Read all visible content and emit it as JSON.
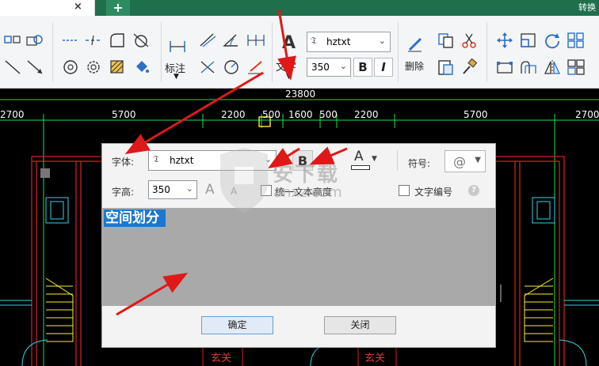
{
  "tabs": {
    "close_glyph": "×",
    "add_glyph": "+",
    "right_label": "转换"
  },
  "ribbon": {
    "annotate_label": "标注",
    "text_label": "文字",
    "font_value": "hztxt",
    "size_value": "350",
    "bold_label": "B",
    "italic_label": "I",
    "delete_label": "删除",
    "text_icon_glyph": "A"
  },
  "cad": {
    "dims_top": [
      "2700",
      "5700",
      "2200",
      "500",
      "1600",
      "500",
      "2200",
      "5700",
      "2700"
    ],
    "total_dim": "23800",
    "room_label": "玄关",
    "colors": {
      "green": "#19e34a",
      "red": "#e02020",
      "cyan": "#2fd6e6",
      "yellow": "#ffee2e"
    }
  },
  "dialog": {
    "font_label": "字体:",
    "font_value": "hztxt",
    "bold_label": "B",
    "italic_label": "I",
    "color_glyph": "A",
    "symbol_label": "符号:",
    "symbol_value": "@",
    "size_label": "字高:",
    "size_value": "350",
    "grow_glyph": "A",
    "shrink_glyph": "A",
    "uniform_label": "统一文本高度",
    "numbering_label": "文字编号",
    "help_glyph": "?",
    "selected_text": "空间划分",
    "ok_label": "确定",
    "close_label": "关闭"
  },
  "watermark": {
    "site": "安下载",
    "url": "anxz.com"
  }
}
